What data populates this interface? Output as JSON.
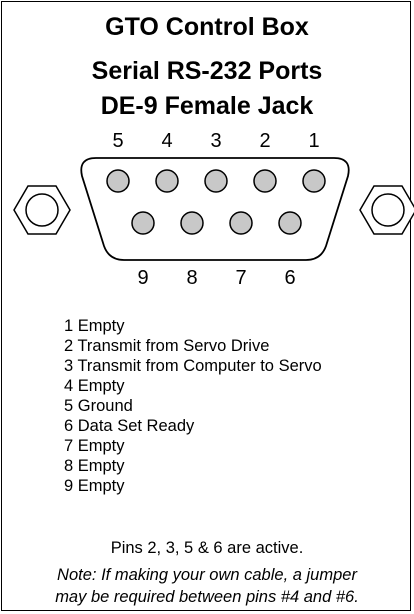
{
  "title": {
    "line1": "GTO Control Box",
    "line2": "Serial RS-232 Ports",
    "line3": "DE-9 Female Jack"
  },
  "connector": {
    "top_row_numbers": [
      "5",
      "4",
      "3",
      "2",
      "1"
    ],
    "bottom_row_numbers": [
      "9",
      "8",
      "7",
      "6"
    ],
    "pin_fill": "#c8c8c8",
    "outline_color": "#000000"
  },
  "pinout": [
    "1 Empty",
    "2 Transmit from Servo Drive",
    "3 Transmit from Computer to Servo",
    "4 Empty",
    "5 Ground",
    "6 Data Set Ready",
    "7 Empty",
    "8 Empty",
    "9 Empty"
  ],
  "active_pins": "Pins 2, 3, 5 & 6 are active.",
  "note": {
    "line1": "Note: If making your own cable, a jumper",
    "line2": "may be required between pins #4 and #6."
  }
}
